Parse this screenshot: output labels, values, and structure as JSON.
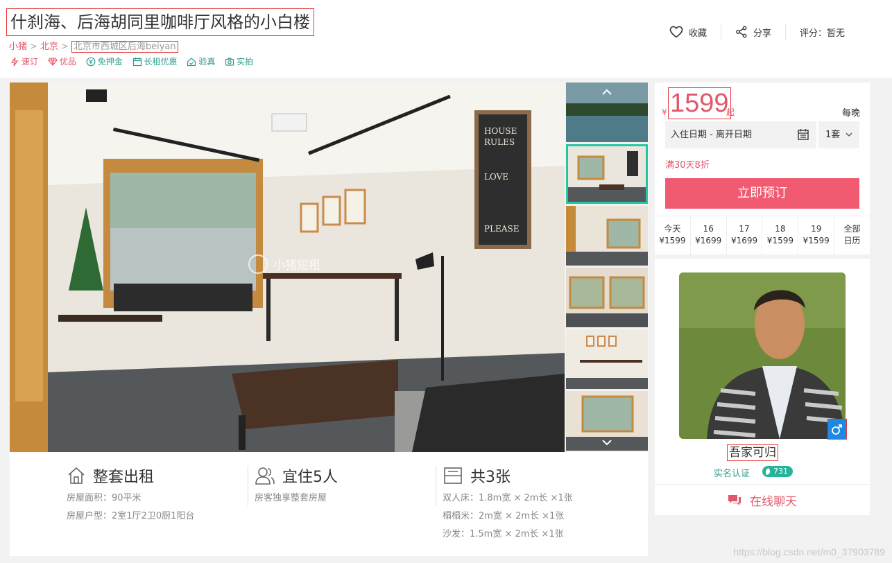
{
  "listing": {
    "title": "什刹海、后海胡同里咖啡厅风格的小白楼",
    "breadcrumb": [
      "小猪",
      "北京",
      "北京市西城区后海beiyan"
    ],
    "tags": [
      "速订",
      "优品",
      "免押金",
      "长租优惠",
      "验真",
      "实拍"
    ]
  },
  "actions": {
    "favorite": "收藏",
    "share": "分享",
    "rating": "评分：暂无"
  },
  "gallery": {
    "photo_watermark": "小猪短租",
    "thumb_count": 6,
    "selected_thumb": 1
  },
  "features": [
    {
      "icon": "house-icon",
      "title": "整套出租",
      "lines": [
        "房屋面积：90平米",
        "房屋户型：2室1厅2卫0厨1阳台"
      ]
    },
    {
      "icon": "people-icon",
      "title": "宜住5人",
      "lines": [
        "房客独享整套房屋"
      ]
    },
    {
      "icon": "bed-icon",
      "title": "共3张",
      "lines": [
        "双人床：1.8m宽 × 2m长 ×1张",
        "榻榻米：2m宽 × 2m长 ×1张",
        "沙发：1.5m宽 × 2m长 ×1张"
      ]
    }
  ],
  "booking": {
    "currency": "¥",
    "price": "1599",
    "price_suffix": "起",
    "per_night": "每晚",
    "dates_label": "入住日期 - 离开日期",
    "units": "1套",
    "promo": "满30天8折",
    "book_button": "立即预订",
    "calendar": [
      {
        "day": "今天",
        "price": "¥1599"
      },
      {
        "day": "16",
        "price": "¥1699"
      },
      {
        "day": "17",
        "price": "¥1699"
      },
      {
        "day": "18",
        "price": "¥1599"
      },
      {
        "day": "19",
        "price": "¥1599"
      },
      {
        "day": "全部",
        "price": "日历"
      }
    ]
  },
  "host": {
    "name": "吾家可归",
    "verified": "实名认证",
    "score": "731",
    "gender_symbol": "♂",
    "chat_button": "在线聊天"
  },
  "watermark": "https://blog.csdn.net/m0_37903789",
  "colors": {
    "accent": "#f05b72",
    "accent_text": "#e0586b",
    "green": "#2a9d8f",
    "selected_thumb_border": "#26c6a5"
  }
}
